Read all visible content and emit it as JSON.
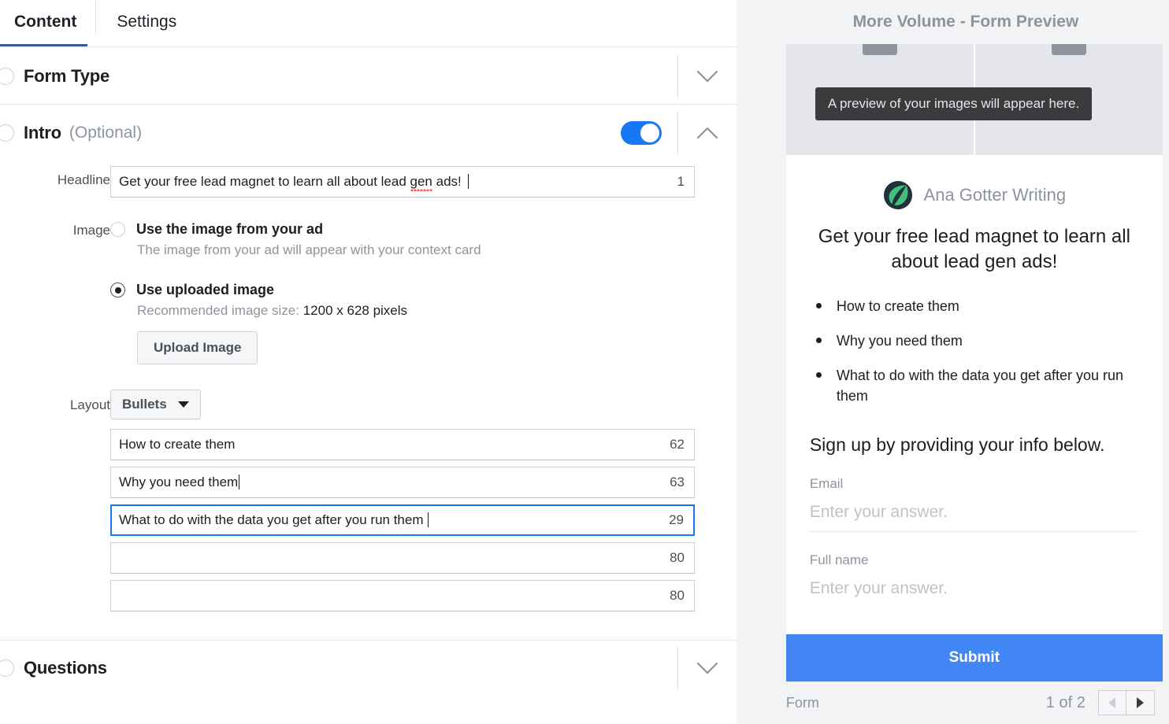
{
  "editor": {
    "tabs": [
      {
        "label": "Content",
        "active": true
      },
      {
        "label": "Settings",
        "active": false
      }
    ],
    "sections": [
      {
        "title": "Form Type",
        "optional": "",
        "expanded": false
      },
      {
        "title": "Intro",
        "optional": "(Optional)",
        "expanded": true
      },
      {
        "title": "Questions",
        "optional": "",
        "expanded": false
      }
    ],
    "intro": {
      "headline": {
        "label": "Headline",
        "value_before": "Get your free lead magnet to learn all about lead ",
        "value_misspelled": "gen",
        "value_after": " ads!",
        "count": "1"
      },
      "image": {
        "label": "Image",
        "option_ad": {
          "label": "Use the image from your ad",
          "sub": "The image from your ad will appear with your context card",
          "selected": false
        },
        "option_upload": {
          "label": "Use uploaded image",
          "sub_prefix": "Recommended image size: ",
          "sub_value": "1200 x 628 pixels",
          "selected": true
        },
        "upload_button": "Upload Image"
      },
      "layout": {
        "label": "Layout",
        "dropdown_value": "Bullets",
        "bullets": [
          {
            "value": "How to create them",
            "count": "62",
            "focused": false,
            "caret": false
          },
          {
            "value": "Why you need them",
            "count": "63",
            "focused": false,
            "caret": true
          },
          {
            "value": "What to do with the data you get after you run them",
            "count": "29",
            "focused": true,
            "caret": true
          },
          {
            "value": "",
            "count": "80",
            "focused": false,
            "caret": false
          },
          {
            "value": "",
            "count": "80",
            "focused": false,
            "caret": false
          }
        ]
      }
    }
  },
  "preview": {
    "title": "More Volume - Form Preview",
    "image_tooltip": "A preview of your images will appear here.",
    "brand_name": "Ana Gotter Writing",
    "headline": "Get your free lead magnet to learn all about lead gen ads!",
    "bullets": [
      "How to create them",
      "Why you need them",
      "What to do with the data you get after you run them"
    ],
    "signup_text": "Sign up by providing your info below.",
    "fields": [
      {
        "label": "Email",
        "placeholder": "Enter your answer."
      },
      {
        "label": "Full name",
        "placeholder": "Enter your answer."
      }
    ],
    "submit_label": "Submit",
    "footer": {
      "label": "Form",
      "pages": "1 of 2"
    }
  },
  "colors": {
    "accent_blue": "#1877f2",
    "tab_underline": "#3b5998",
    "submit_blue": "#4285f4",
    "avatar_green": "#3ec17a",
    "avatar_dark": "#22303c"
  }
}
